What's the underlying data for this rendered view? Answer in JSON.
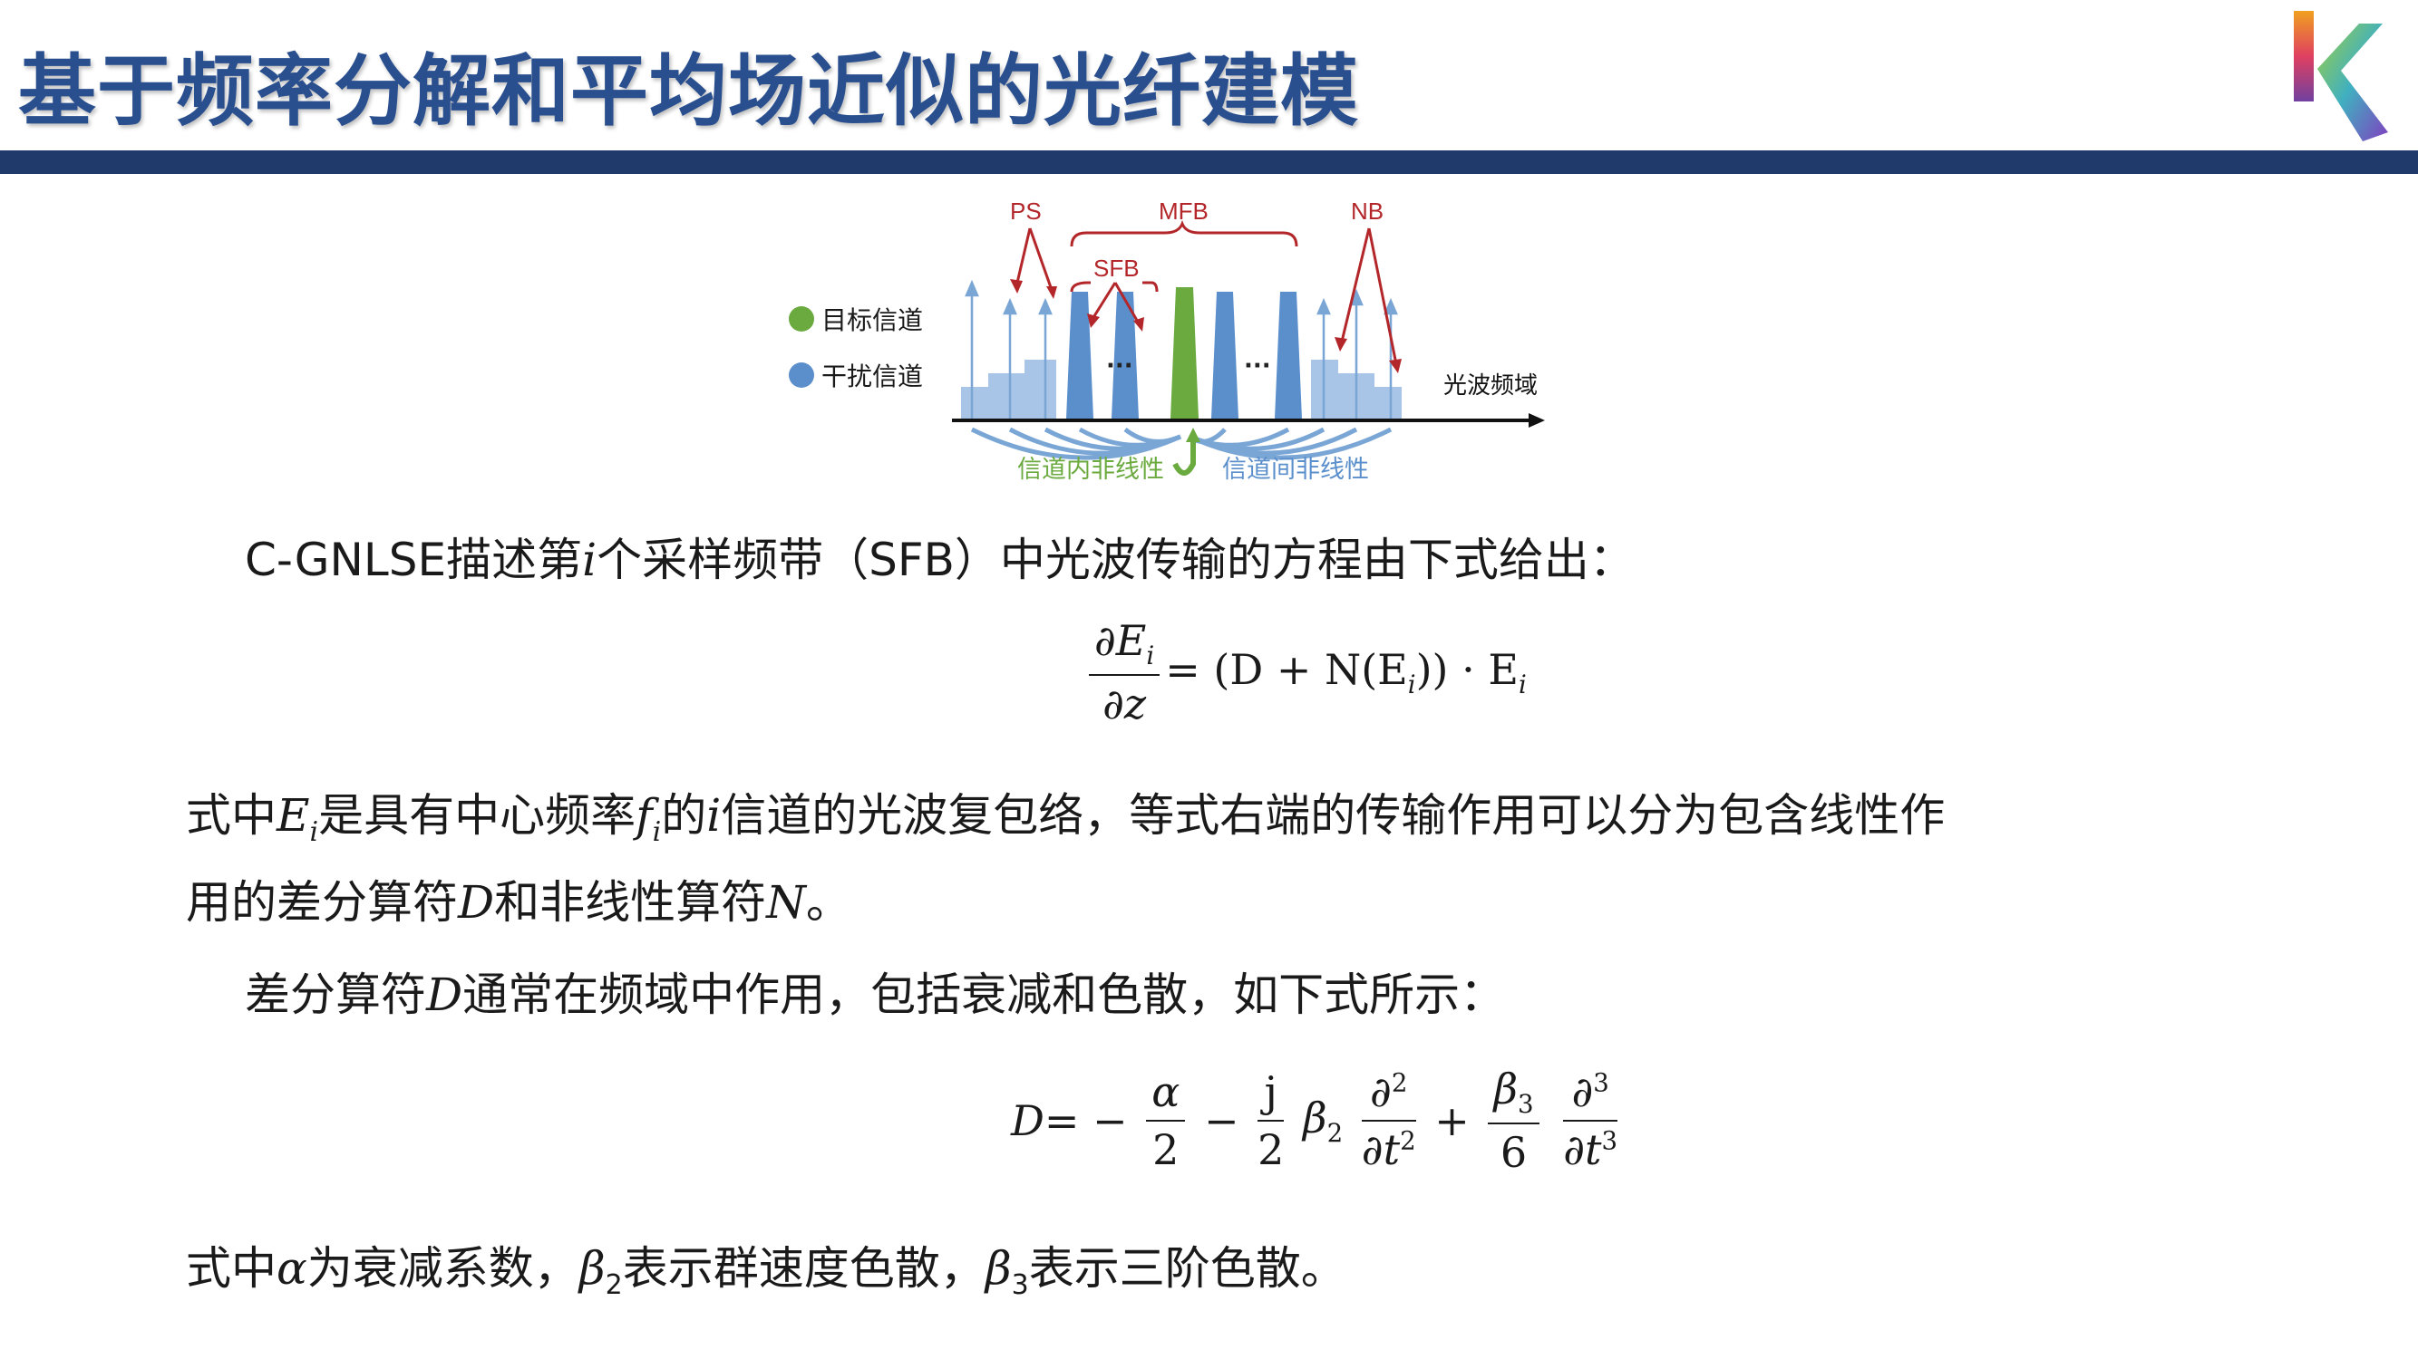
{
  "title": "基于频率分解和平均场近似的光纤建模",
  "figure": {
    "label_ps": "PS",
    "label_mfb": "MFB",
    "label_nb": "NB",
    "label_sfb": "SFB",
    "legend_target": "目标信道",
    "legend_interf": "干扰信道",
    "axis_label": "光波频域",
    "dots": "···",
    "intra_label": "信道内非线性",
    "inter_label": "信道间非线性",
    "colors": {
      "target": "#6aaa3e",
      "interf": "#5b8fcc",
      "arrow_red": "#b3262a",
      "arrow_blue": "#7aa6d6"
    }
  },
  "para1": {
    "before": "C-GNLSE描述第",
    "var": "i",
    "after": "个采样频带（SFB）中光波传输的方程由下式给出："
  },
  "eq1": {
    "num": "∂E",
    "num_sub": "i",
    "den": "∂z",
    "rhs": "= (D + N(E",
    "rhs_sub": "i",
    "rhs_end": ")) · E",
    "rhs_end_sub": "i"
  },
  "para2": {
    "t1": "式中",
    "E": "E",
    "E_sub": "i",
    "t2": "是具有中心频率",
    "f": "f",
    "f_sub": "i",
    "t3": "的",
    "i": "i",
    "t4": "信道的光波复包络，等式右端的传输作用可以分为包含线性作",
    "t5": "用的差分算符",
    "D": "D",
    "t6": "和非线性算符",
    "N": "N",
    "t7": "。"
  },
  "para3": {
    "t1": "差分算符",
    "D": "D",
    "t2": "通常在频域中作用，包括衰减和色散，如下式所示："
  },
  "eq2": {
    "lhs": "D",
    "eq": "= −",
    "a_num": "α",
    "a_den": "2",
    "minus": "−",
    "j_num": "j",
    "j_den": "2",
    "beta2": "β",
    "beta2_sub": "2",
    "d2_num": "∂",
    "d2_num_sup": "2",
    "d2_den": "∂t",
    "d2_den_sup": "2",
    "plus": "+",
    "b3_num": "β",
    "b3_num_sub": "3",
    "b3_den": "6",
    "d3_num": "∂",
    "d3_num_sup": "3",
    "d3_den": "∂t",
    "d3_den_sup": "3"
  },
  "para4": {
    "t1": "式中",
    "alpha": "α",
    "t2": "为衰减系数，",
    "b2": "β",
    "b2_sub": "2",
    "t3": "表示群速度色散，",
    "b3": "β",
    "b3_sub": "3",
    "t4": "表示三阶色散。"
  }
}
